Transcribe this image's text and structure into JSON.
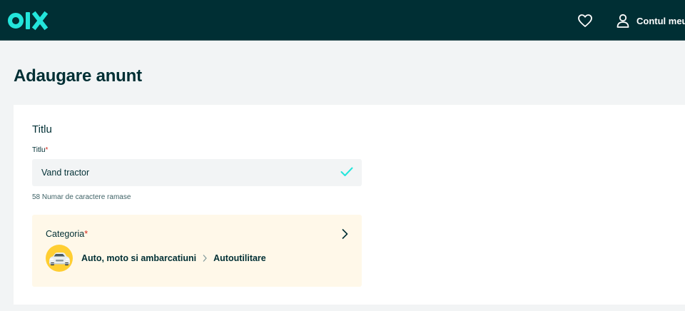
{
  "header": {
    "logo_text": "OLX",
    "account_label": "Contul meu",
    "colors": {
      "bar": "#002f34",
      "logo": "#23e5db"
    },
    "icons": [
      "heart-icon",
      "user-icon"
    ]
  },
  "page": {
    "title": "Adaugare anunt"
  },
  "form": {
    "section_title": "Titlu",
    "title_field": {
      "label": "Titlu",
      "required_mark": "*",
      "value": "Vand tractor",
      "helper": "58 Numar de caractere ramase"
    },
    "category": {
      "label": "Categoria",
      "required_mark": "*",
      "path": [
        "Auto, moto si ambarcatiuni",
        "Autoutilitare"
      ],
      "background": "#fff8e9"
    }
  }
}
